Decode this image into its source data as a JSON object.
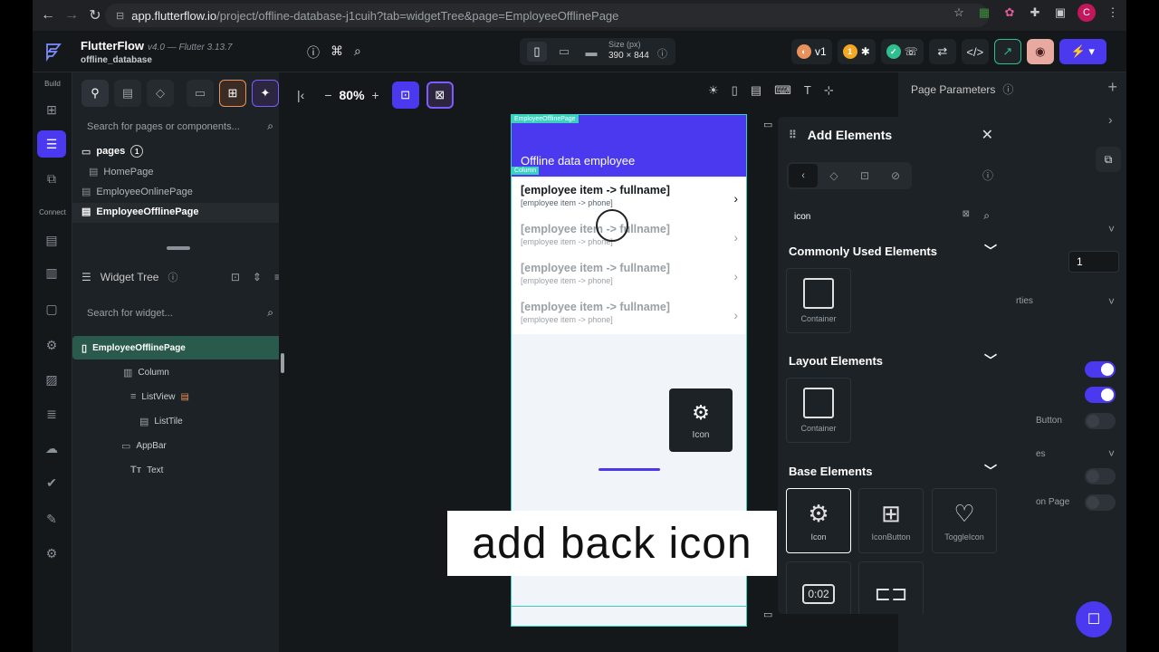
{
  "browser": {
    "url_domain": "app.flutterflow.io",
    "url_path": "/project/offline-database-j1cuih?tab=widgetTree&page=EmployeeOfflinePage",
    "profile_initial": "C"
  },
  "header": {
    "app_name": "FlutterFlow",
    "version": "v4.0 — Flutter 3.13.7",
    "project_name": "offline_database",
    "size_label": "Size (px)",
    "size_value": "390 × 844",
    "version_pill": "v1",
    "notification_count": "1"
  },
  "rail": {
    "build_label": "Build",
    "connect_label": "Connect"
  },
  "left_panel": {
    "search_placeholder": "Search for pages or components...",
    "pages_label": "pages",
    "pages_count": "1",
    "pages": [
      "HomePage",
      "EmployeeOnlinePage",
      "EmployeeOfflinePage"
    ],
    "widget_tree_label": "Widget Tree",
    "widget_search_placeholder": "Search for widget...",
    "tree": {
      "root": "EmployeeOfflinePage",
      "column": "Column",
      "listview": "ListView",
      "listtile": "ListTile",
      "appbar": "AppBar",
      "text": "Text"
    }
  },
  "canvas": {
    "zoom": "80%",
    "page_tag": "EmployeeOfflinePage",
    "column_tag": "Column",
    "appbar_title": "Offline data employee",
    "list_items": [
      {
        "title": "[employee item -> fullname]",
        "subtitle": "[employee item -> phone]"
      },
      {
        "title": "[employee item -> fullname]",
        "subtitle": "[employee item -> phone]"
      },
      {
        "title": "[employee item -> fullname]",
        "subtitle": "[employee item -> phone]"
      },
      {
        "title": "[employee item -> fullname]",
        "subtitle": "[employee item -> phone]"
      }
    ],
    "drag_card_label": "Icon",
    "caption": "add back icon"
  },
  "add_elements": {
    "title": "Add Elements",
    "search_value": "icon",
    "sections": {
      "common": "Commonly Used Elements",
      "layout": "Layout Elements",
      "base": "Base Elements"
    },
    "common_items": [
      "Container"
    ],
    "layout_items": [
      "Container"
    ],
    "base_items": [
      "Icon",
      "IconButton",
      "ToggleIcon"
    ],
    "timer_label": "0:02"
  },
  "right_panel": {
    "title": "Page Parameters",
    "number_value": "1",
    "frag_properties": "rties",
    "frag_button": "Button",
    "frag_es": "es",
    "frag_page": "on Page"
  },
  "colors": {
    "primary": "#4b39ef",
    "tertiary": "#39d2c0",
    "bg": "#14181b"
  }
}
